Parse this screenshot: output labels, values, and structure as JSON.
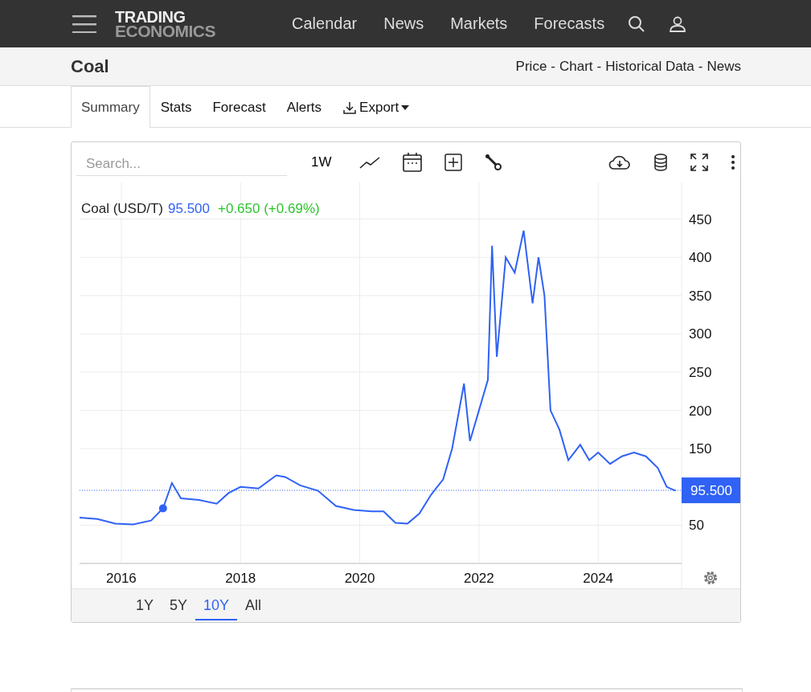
{
  "header": {
    "logo_top": "TRADING",
    "logo_bottom": "ECONOMICS",
    "nav": [
      "Calendar",
      "News",
      "Markets",
      "Forecasts"
    ]
  },
  "subheader": {
    "title": "Coal",
    "links": [
      "Price",
      "Chart",
      "Historical Data",
      "News"
    ],
    "separator": "-"
  },
  "tabs": [
    {
      "label": "Summary",
      "selected": true
    },
    {
      "label": "Stats",
      "selected": false
    },
    {
      "label": "Forecast",
      "selected": false
    },
    {
      "label": "Alerts",
      "selected": false
    },
    {
      "label": "Export",
      "selected": false,
      "kind": "dropdown"
    }
  ],
  "chart": {
    "search": {
      "placeholder": "Search..."
    },
    "interval": "1W",
    "last_price": "95.500",
    "change": "+0.650 (+0.69%)",
    "ranges": [
      {
        "label": "1Y",
        "selected": false
      },
      {
        "label": "5Y",
        "selected": false
      },
      {
        "label": "10Y",
        "selected": true
      },
      {
        "label": "All",
        "selected": false
      }
    ],
    "chart_data": {
      "type": "line",
      "title": "Coal (USD/T)",
      "x": [
        2015.3,
        2015.6,
        2015.9,
        2016.2,
        2016.5,
        2016.7,
        2016.85,
        2017.0,
        2017.3,
        2017.6,
        2017.8,
        2018.0,
        2018.3,
        2018.6,
        2018.75,
        2019.0,
        2019.3,
        2019.6,
        2019.9,
        2020.2,
        2020.4,
        2020.6,
        2020.8,
        2021.0,
        2021.2,
        2021.4,
        2021.55,
        2021.75,
        2021.85,
        2022.0,
        2022.15,
        2022.22,
        2022.3,
        2022.45,
        2022.6,
        2022.75,
        2022.9,
        2023.0,
        2023.1,
        2023.2,
        2023.35,
        2023.5,
        2023.7,
        2023.85,
        2024.0,
        2024.2,
        2024.4,
        2024.6,
        2024.8,
        2025.0,
        2025.15,
        2025.3
      ],
      "series": [
        {
          "color": "#2f62f5",
          "values": [
            60,
            58,
            52,
            51,
            56,
            72,
            105,
            85,
            83,
            78,
            92,
            100,
            98,
            115,
            113,
            102,
            95,
            75,
            70,
            68,
            68,
            53,
            52,
            65,
            90,
            110,
            150,
            235,
            160,
            200,
            240,
            415,
            270,
            400,
            380,
            435,
            340,
            400,
            350,
            200,
            175,
            135,
            155,
            135,
            145,
            130,
            140,
            145,
            140,
            125,
            100,
            95
          ]
        }
      ],
      "xticks": [
        {
          "value": 2016,
          "label": "2016"
        },
        {
          "value": 2018,
          "label": "2018"
        },
        {
          "value": 2020,
          "label": "2020"
        },
        {
          "value": 2022,
          "label": "2022"
        },
        {
          "value": 2024,
          "label": "2024"
        }
      ],
      "yticks": [
        50,
        150,
        200,
        250,
        300,
        350,
        400,
        450
      ],
      "ylim": [
        0,
        500
      ],
      "xlim": [
        2015.3,
        2025.4
      ],
      "grid": true,
      "ref_lines": [
        {
          "axis": "y",
          "value": 95.5,
          "label": "95.500",
          "color": "#2f62f5"
        }
      ]
    }
  }
}
